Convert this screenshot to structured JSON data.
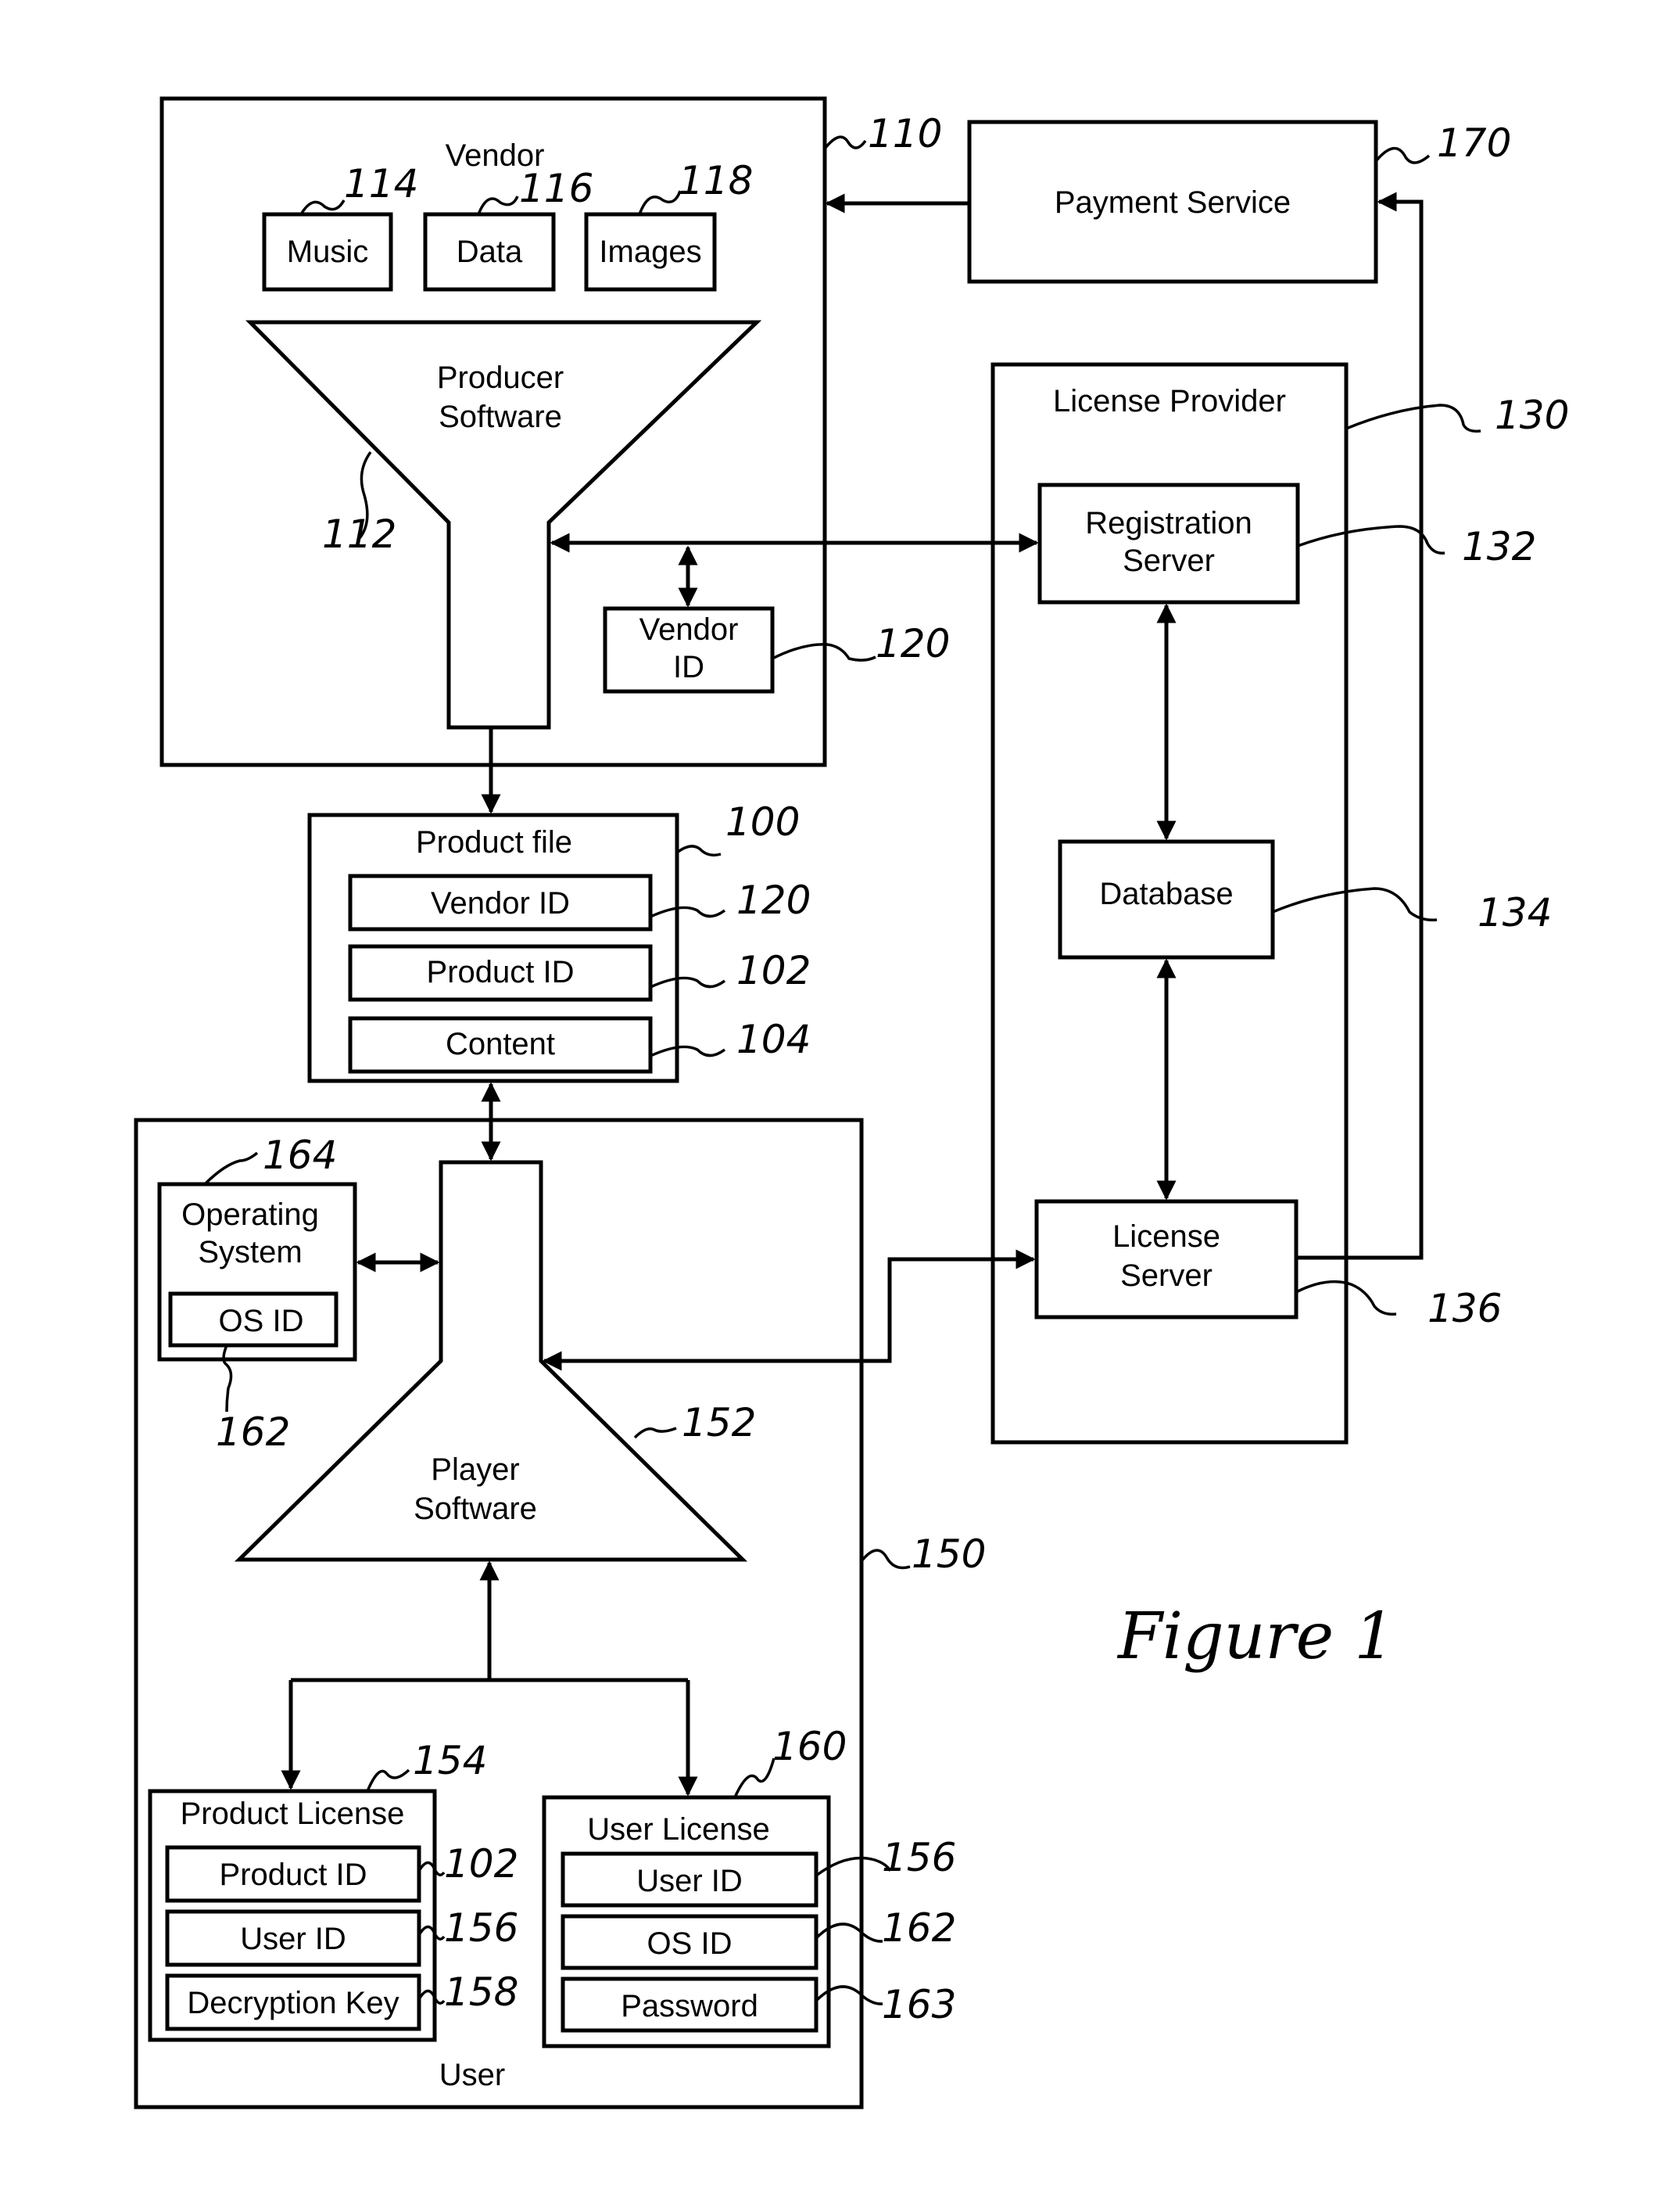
{
  "figure_title": "Figure 1",
  "vendor": {
    "label": "Vendor",
    "ref": "110",
    "items": [
      {
        "label": "Music",
        "ref": "114"
      },
      {
        "label": "Data",
        "ref": "116"
      },
      {
        "label": "Images",
        "ref": "118"
      }
    ],
    "producer_software": {
      "line1": "Producer",
      "line2": "Software",
      "ref": "112"
    },
    "vendor_id": {
      "line1": "Vendor",
      "line2": "ID",
      "ref": "120"
    }
  },
  "payment_service": {
    "label": "Payment Service",
    "ref": "170"
  },
  "license_provider": {
    "label": "License Provider",
    "ref": "130",
    "registration_server": {
      "line1": "Registration",
      "line2": "Server",
      "ref": "132"
    },
    "database": {
      "label": "Database",
      "ref": "134"
    },
    "license_server": {
      "line1": "License",
      "line2": "Server",
      "ref": "136"
    }
  },
  "product_file": {
    "label": "Product file",
    "ref": "100",
    "fields": [
      {
        "label": "Vendor ID",
        "ref": "120"
      },
      {
        "label": "Product ID",
        "ref": "102"
      },
      {
        "label": "Content",
        "ref": "104"
      }
    ]
  },
  "user": {
    "label": "User",
    "ref": "150",
    "operating_system": {
      "line1": "Operating",
      "line2": "System",
      "ref": "164",
      "os_id": {
        "label": "OS ID",
        "ref": "162"
      }
    },
    "player_software": {
      "line1": "Player",
      "line2": "Software",
      "ref": "152"
    },
    "product_license": {
      "label": "Product License",
      "ref": "154",
      "fields": [
        {
          "label": "Product ID",
          "ref": "102"
        },
        {
          "label": "User ID",
          "ref": "156"
        },
        {
          "label": "Decryption Key",
          "ref": "158"
        }
      ]
    },
    "user_license": {
      "label": "User License",
      "ref": "160",
      "fields": [
        {
          "label": "User ID",
          "ref": "156"
        },
        {
          "label": "OS ID",
          "ref": "162"
        },
        {
          "label": "Password",
          "ref": "163"
        }
      ]
    }
  }
}
